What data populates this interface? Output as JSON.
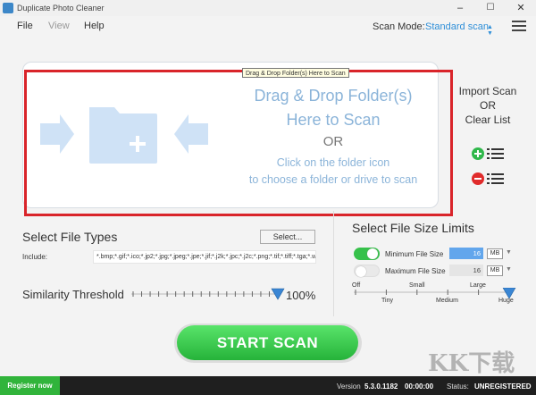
{
  "window": {
    "title": "Duplicate Photo Cleaner",
    "minimize": "–",
    "maximize": "☐",
    "close": "✕"
  },
  "menu": {
    "file": "File",
    "view": "View",
    "help": "Help"
  },
  "scan_mode": {
    "label": "Scan Mode:",
    "value": "Standard scan"
  },
  "dropzone": {
    "tooltip": "Drag & Drop Folder(s) Here to Scan",
    "line1": "Drag & Drop Folder(s)",
    "line2": "Here to Scan",
    "or": "OR",
    "line3": "Click on the folder icon",
    "line4": "to choose a folder or drive to scan"
  },
  "side_panel": {
    "line1": "Import Scan",
    "line2": "OR",
    "line3": "Clear List"
  },
  "file_types": {
    "title": "Select File Types",
    "select_button": "Select...",
    "include_label": "Include:",
    "include_value": "*.bmp;*.gif;*.ico;*.jp2;*.jpg;*.jpeg;*.jpe;*.jif;*.j2k;*.jpc;*.j2c;*.png;*.tif;*.tiff;*.tga;*.w"
  },
  "similarity": {
    "title": "Similarity Threshold",
    "value": "100%",
    "level": 1.0
  },
  "file_size": {
    "title": "Select File Size Limits",
    "min": {
      "label": "Minimum File Size",
      "value": "16",
      "unit": "MB",
      "enabled": true
    },
    "max": {
      "label": "Maximum File Size",
      "value": "16",
      "unit": "MB",
      "enabled": false
    },
    "scale_top": [
      "Off",
      "Small",
      "Large"
    ],
    "scale_bottom": [
      "Tiny",
      "Medium",
      "Huge"
    ],
    "level": 1.0
  },
  "scan_button": "START SCAN",
  "status": {
    "register": "Register now",
    "version_label": "Version",
    "version": "5.3.0.1182",
    "time": "00:00:00",
    "status_label": "Status:",
    "status_value": "UNREGISTERED"
  },
  "watermark": "KK下载",
  "colors": {
    "accent": "#2f8fd8",
    "start_green": "#26b33a",
    "highlight_red": "#d9242a",
    "toggle_on": "#36c14a"
  }
}
